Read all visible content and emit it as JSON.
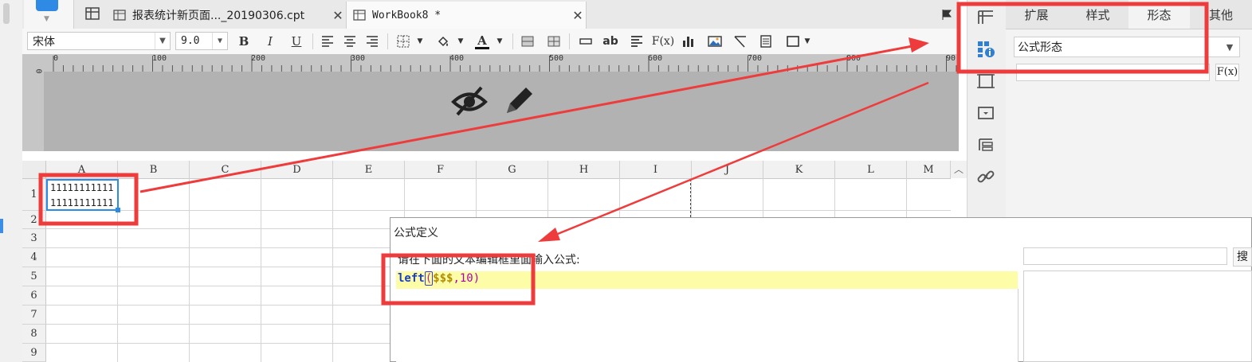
{
  "tabs": {
    "tab1_label": "报表统计新页面..._20190306.cpt",
    "tab1_close": "✕",
    "tab2_label": "WorkBook8 *",
    "tab2_close": "✕"
  },
  "toolbar": {
    "font": "宋体",
    "size": "9.0",
    "bold": "B",
    "italic": "I",
    "underline": "U",
    "font_color_letter": "A",
    "ab_label": "ab",
    "fx_label": "F(x)"
  },
  "ruler": {
    "ticks": [
      "0",
      "100",
      "200",
      "300",
      "400",
      "500",
      "600",
      "700",
      "800",
      "90"
    ],
    "vertical_zero": "0"
  },
  "grid": {
    "columns": [
      "A",
      "B",
      "C",
      "D",
      "E",
      "F",
      "G",
      "H",
      "I",
      "J",
      "K",
      "L",
      "M"
    ],
    "rows": [
      "1",
      "2",
      "3",
      "4",
      "5",
      "6",
      "7",
      "8",
      "9"
    ],
    "cell_a1_line1": "11111111111",
    "cell_a1_line2": "11111111111"
  },
  "panel": {
    "tabs": [
      "扩展",
      "样式",
      "形态",
      "其他"
    ],
    "active_tab": "形态",
    "shape_select": "公式形态",
    "fx_button": "F(x)"
  },
  "dialog": {
    "title": "公式定义",
    "prompt": "请在下面的文本编辑框里面输入公式:",
    "formula_fn": "left",
    "formula_open": "(",
    "formula_arg": "$$$",
    "formula_rest": ",10)",
    "search_button": "搜"
  },
  "colors": {
    "annotation_red": "#ee3b3b",
    "selection_blue": "#2b8be8",
    "editor_yellow": "#fdfda8"
  }
}
